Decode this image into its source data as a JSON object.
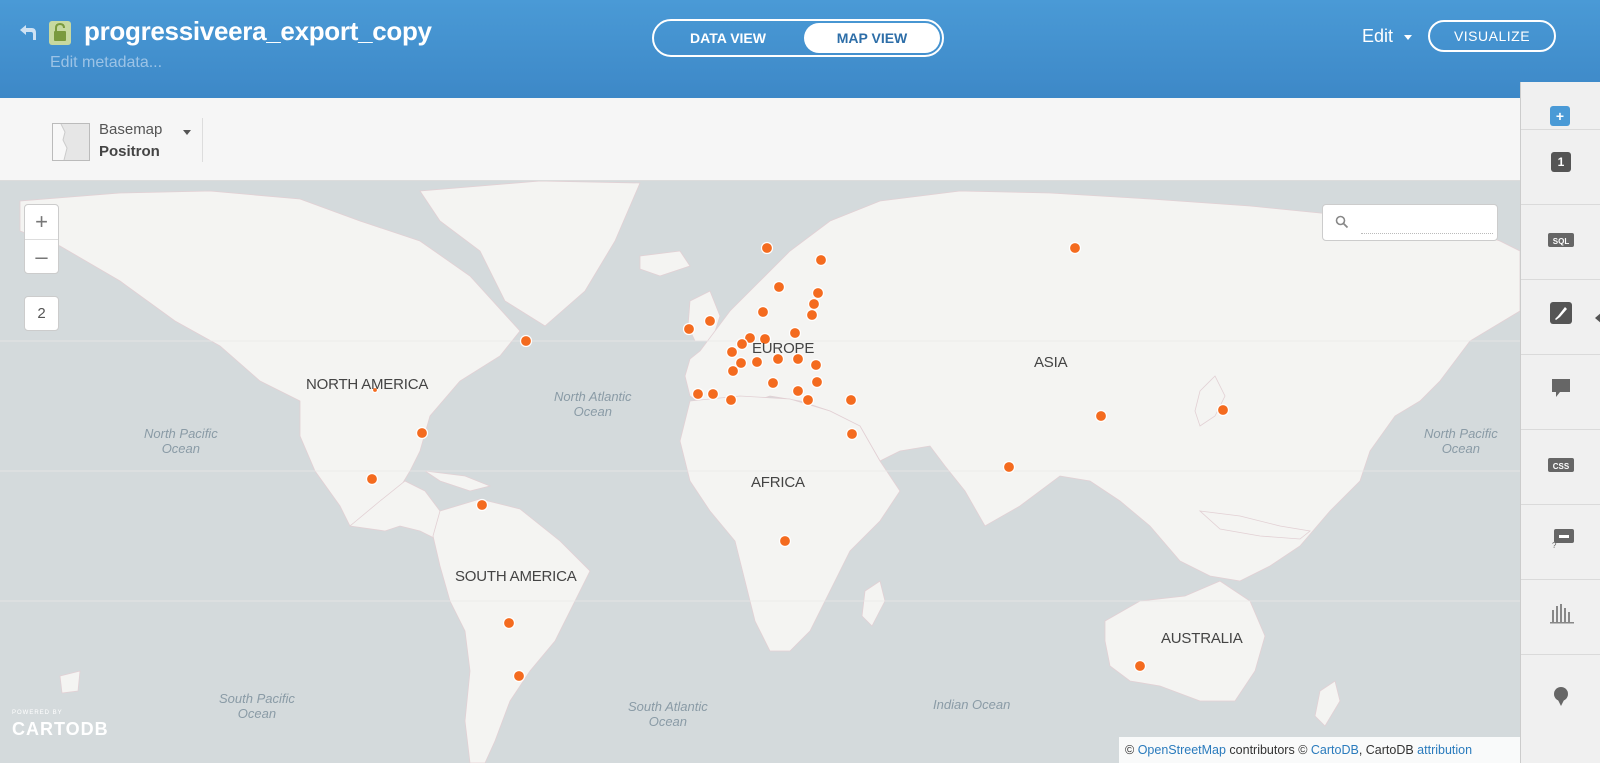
{
  "header": {
    "title": "progressiveera_export_copy",
    "subtitle": "Edit metadata...",
    "views": [
      "DATA VIEW",
      "MAP VIEW"
    ],
    "active_view": "MAP VIEW",
    "edit_label": "Edit",
    "visualize_label": "VISUALIZE",
    "colors": {
      "header_bg": "#4094d2",
      "accent": "#2d6ea8",
      "point": "#f46b1f"
    }
  },
  "toolbar": {
    "basemap_label": "Basemap",
    "basemap_value": "Positron"
  },
  "map": {
    "zoom_in": "+",
    "zoom_out": "–",
    "zoom_level": "2",
    "search_placeholder": "",
    "labels": {
      "north_america": "NORTH AMERICA",
      "europe": "EUROPE",
      "asia": "ASIA",
      "africa": "AFRICA",
      "south_america": "SOUTH AMERICA",
      "australia": "AUSTRALIA"
    },
    "oceans": {
      "north_atlantic_1": "North Atlantic",
      "north_atlantic_2": "Ocean",
      "north_pacific_w_1": "North Pacific",
      "north_pacific_w_2": "Ocean",
      "north_pacific_e_1": "North Pacific",
      "north_pacific_e_2": "Ocean",
      "south_pacific_1": "South Pacific",
      "south_pacific_2": "Ocean",
      "south_atlantic_1": "South Atlantic",
      "south_atlantic_2": "Ocean",
      "indian": "Indian Ocean"
    },
    "powered_by": "POWERED BY",
    "logo": "CARTODB",
    "attribution": {
      "copy1": "© ",
      "osm": "OpenStreetMap",
      "contributors": " contributors © ",
      "cartodb": "CartoDB",
      "sep": ", CartoDB ",
      "attr": "attribution"
    }
  },
  "side_panel": {
    "layer_number": "1",
    "tabs": [
      "sql-icon",
      "wizard-icon",
      "infowindow-icon",
      "css-icon",
      "legend-icon",
      "filter-icon",
      "annotation-icon"
    ]
  }
}
